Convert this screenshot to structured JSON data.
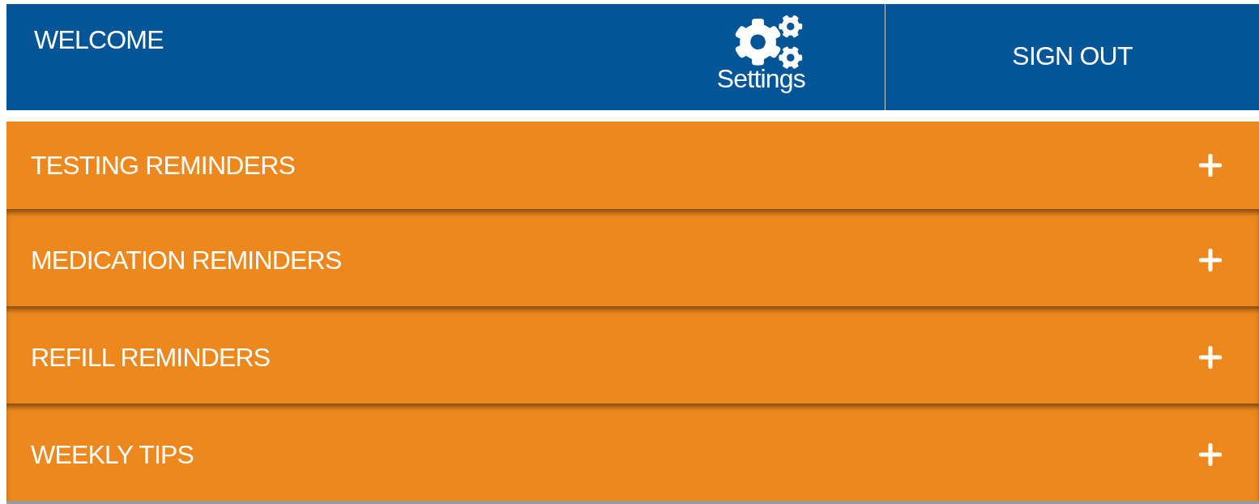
{
  "header": {
    "welcome": "WELCOME",
    "settings": "Settings",
    "sign_out": "SIGN OUT"
  },
  "sections": [
    {
      "label": "TESTING REMINDERS",
      "expanded": false
    },
    {
      "label": "MEDICATION REMINDERS",
      "expanded": false
    },
    {
      "label": "REFILL REMINDERS",
      "expanded": false
    },
    {
      "label": "WEEKLY TIPS",
      "expanded": false
    }
  ]
}
